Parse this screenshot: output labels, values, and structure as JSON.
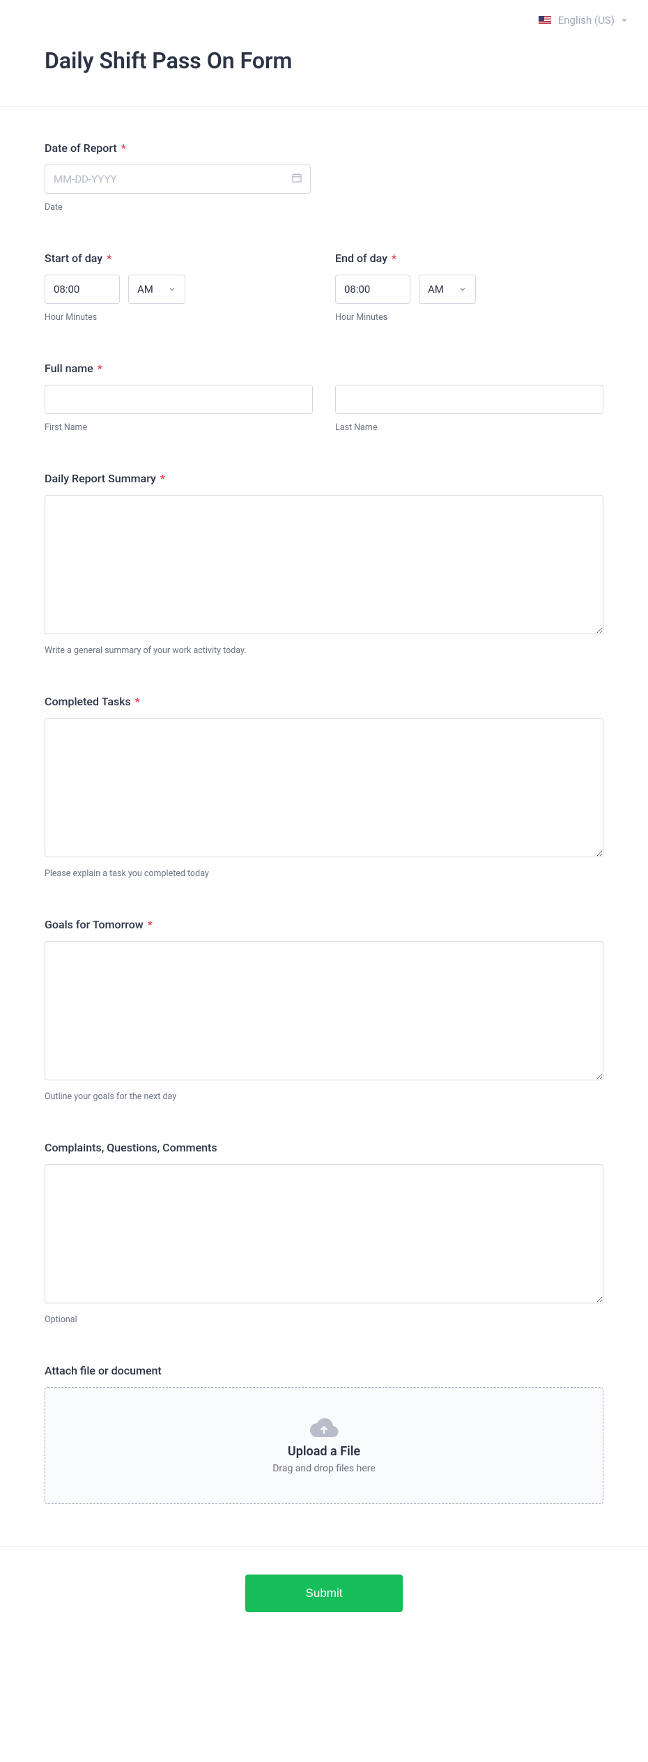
{
  "header": {
    "language": "English (US)"
  },
  "title": "Daily Shift Pass On Form",
  "fields": {
    "date": {
      "label": "Date of Report",
      "placeholder": "MM-DD-YYYY",
      "sublabel": "Date"
    },
    "start": {
      "label": "Start of day",
      "value": "08:00",
      "meridiem": "AM",
      "sublabel": "Hour Minutes"
    },
    "end": {
      "label": "End of day",
      "value": "08:00",
      "meridiem": "AM",
      "sublabel": "Hour Minutes"
    },
    "name": {
      "label": "Full name",
      "first_sub": "First Name",
      "last_sub": "Last Name"
    },
    "summary": {
      "label": "Daily Report Summary",
      "sublabel": "Write a general summary of your work activity today."
    },
    "completed": {
      "label": "Completed Tasks",
      "sublabel": "Please explain a task you completed today"
    },
    "goals": {
      "label": "Goals for Tomorrow",
      "sublabel": "Outline your goals for the next day"
    },
    "comments": {
      "label": "Complaints, Questions, Comments",
      "sublabel": "Optional"
    },
    "attach": {
      "label": "Attach file or document",
      "upload_title": "Upload a File",
      "upload_sub": "Drag and drop files here"
    }
  },
  "submit": "Submit"
}
